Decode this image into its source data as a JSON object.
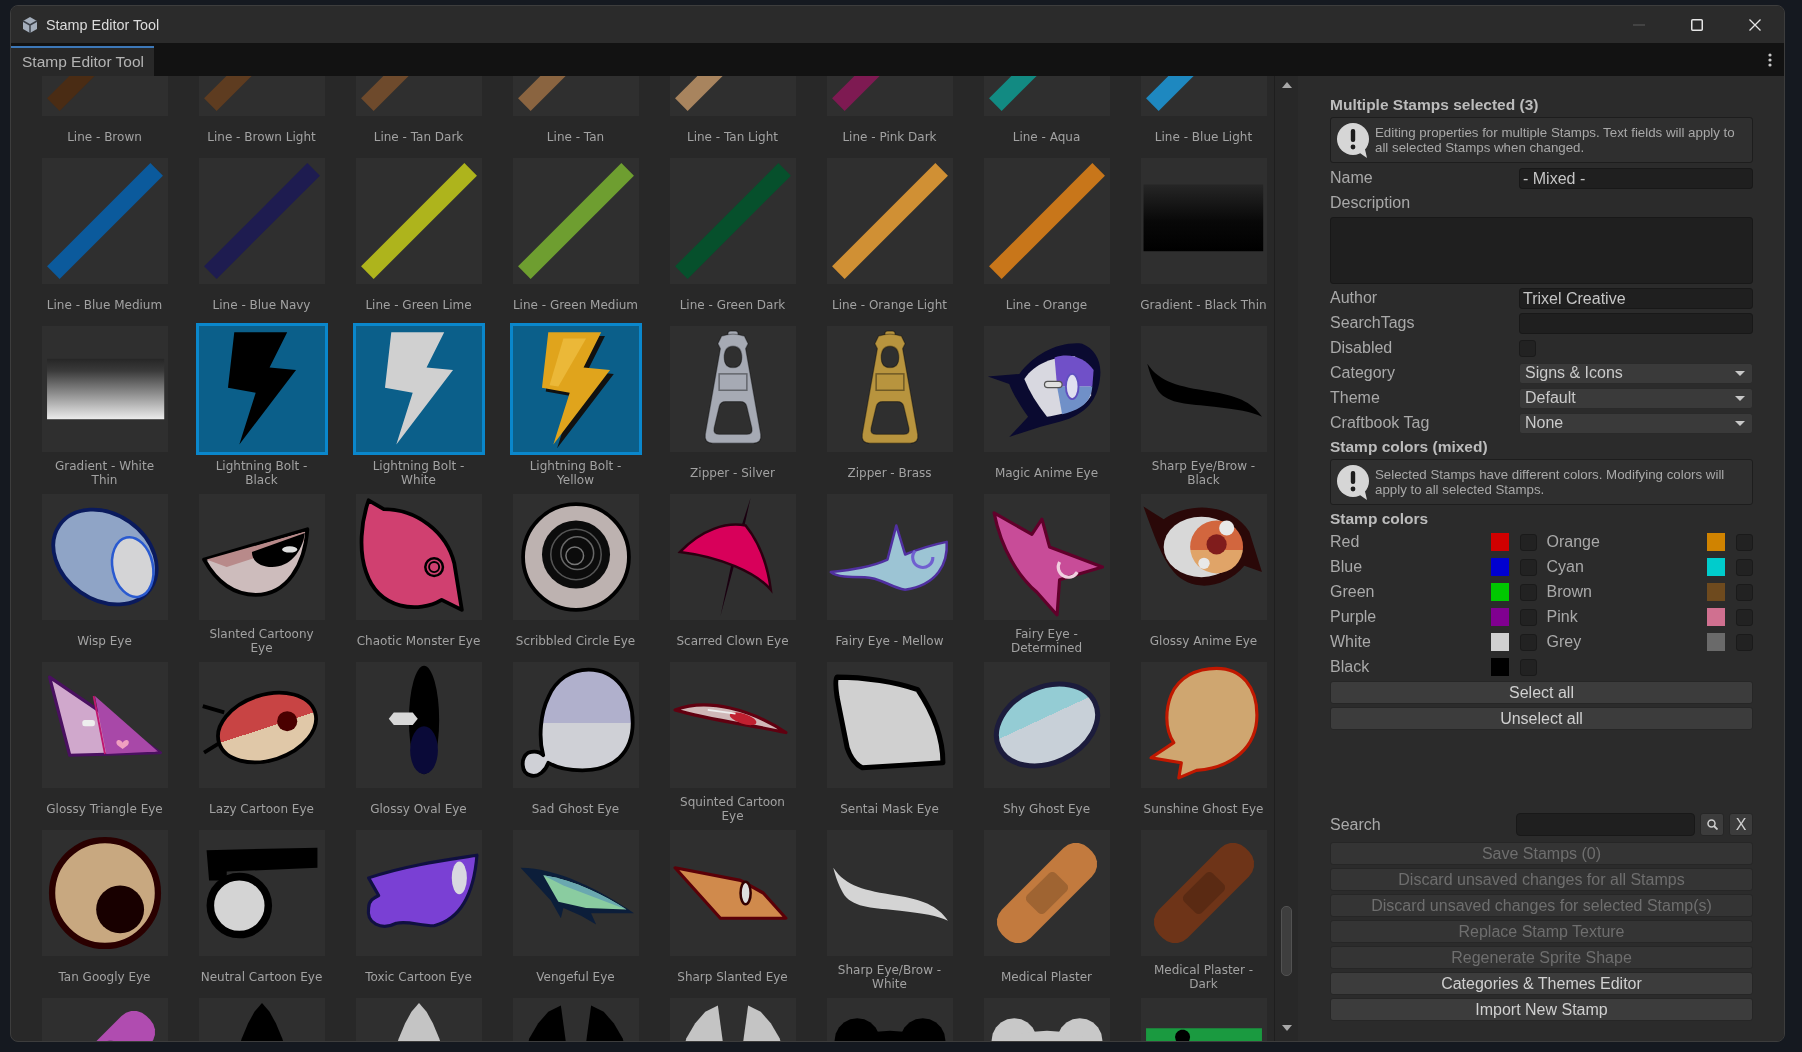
{
  "window": {
    "title": "Stamp Editor Tool",
    "controls": [
      {
        "kind": "minimize",
        "disabled": true
      },
      {
        "kind": "maximize",
        "disabled": false
      },
      {
        "kind": "close",
        "disabled": false
      }
    ]
  },
  "tabs": [
    {
      "label": "Stamp Editor Tool",
      "selected": true
    }
  ],
  "stamps": [
    {
      "label": "Line - Brown",
      "kind": "line",
      "color": "#4a2c14",
      "selected": false
    },
    {
      "label": "Line - Brown Light",
      "kind": "line",
      "color": "#5e3c20",
      "selected": false
    },
    {
      "label": "Line - Tan Dark",
      "kind": "line",
      "color": "#6e4a2c",
      "selected": false
    },
    {
      "label": "Line - Tan",
      "kind": "line",
      "color": "#8a6440",
      "selected": false
    },
    {
      "label": "Line - Tan Light",
      "kind": "line",
      "color": "#a8845e",
      "selected": false
    },
    {
      "label": "Line - Pink Dark",
      "kind": "line",
      "color": "#7e1a52",
      "selected": false
    },
    {
      "label": "Line - Aqua",
      "kind": "line",
      "color": "#128a82",
      "selected": false
    },
    {
      "label": "Line - Blue Light",
      "kind": "line",
      "color": "#1e88c0",
      "selected": false
    },
    {
      "label": "Line - Blue Medium",
      "kind": "line",
      "color": "#0b5a9c",
      "selected": false
    },
    {
      "label": "Line - Blue Navy",
      "kind": "line",
      "color": "#1e1c50",
      "selected": false
    },
    {
      "label": "Line - Green Lime",
      "kind": "line",
      "color": "#aeb41c",
      "selected": false
    },
    {
      "label": "Line - Green Medium",
      "kind": "line",
      "color": "#6e9e30",
      "selected": false
    },
    {
      "label": "Line - Green Dark",
      "kind": "line",
      "color": "#06502c",
      "selected": false
    },
    {
      "label": "Line - Orange Light",
      "kind": "line",
      "color": "#d09034",
      "selected": false
    },
    {
      "label": "Line - Orange",
      "kind": "line",
      "color": "#c8761a",
      "selected": false
    },
    {
      "label": "Gradient - Black Thin",
      "kind": "darkfade",
      "selected": false
    },
    {
      "label": "Gradient - White Thin",
      "kind": "lightfade",
      "selected": false
    },
    {
      "label": "Lightning Bolt - Black",
      "kind": "bolt",
      "color": "#000000",
      "selected": true
    },
    {
      "label": "Lightning Bolt - White",
      "kind": "bolt",
      "color": "#d0d0d0",
      "selected": true
    },
    {
      "label": "Lightning Bolt - Yellow",
      "kind": "glossybolt",
      "color": "#e0a41c",
      "selected": true
    },
    {
      "label": "Zipper - Silver",
      "kind": "zipper",
      "color": "#a6aab4",
      "selected": false
    },
    {
      "label": "Zipper - Brass",
      "kind": "zipper",
      "color": "#b8943e",
      "selected": false
    },
    {
      "label": "Magic Anime Eye",
      "kind": "magic",
      "selected": false
    },
    {
      "label": "Sharp Eye/Brow - Black",
      "kind": "brow",
      "color": "#000000",
      "selected": false
    },
    {
      "label": "Wisp Eye",
      "kind": "wisp",
      "selected": false
    },
    {
      "label": "Slanted Cartoony Eye",
      "kind": "slanted",
      "selected": false
    },
    {
      "label": "Chaotic Monster Eye",
      "kind": "monster",
      "selected": false
    },
    {
      "label": "Scribbled Circle Eye",
      "kind": "scribble",
      "selected": false
    },
    {
      "label": "Scarred Clown Eye",
      "kind": "clown",
      "selected": false
    },
    {
      "label": "Fairy Eye - Mellow",
      "kind": "fairy",
      "selected": false
    },
    {
      "label": "Fairy Eye - Determined",
      "kind": "spiky",
      "selected": false
    },
    {
      "label": "Glossy Anime Eye",
      "kind": "anime",
      "selected": false
    },
    {
      "label": "Glossy Triangle Eye",
      "kind": "triangle",
      "selected": false
    },
    {
      "label": "Lazy Cartoon Eye",
      "kind": "lazy",
      "selected": false
    },
    {
      "label": "Glossy Oval Eye",
      "kind": "oval",
      "selected": false
    },
    {
      "label": "Sad Ghost Eye",
      "kind": "ghost",
      "selected": false
    },
    {
      "label": "Squinted Cartoon Eye",
      "kind": "squint",
      "selected": false
    },
    {
      "label": "Sentai Mask Eye",
      "kind": "mask",
      "selected": false
    },
    {
      "label": "Shy Ghost Eye",
      "kind": "shy",
      "selected": false
    },
    {
      "label": "Sunshine Ghost Eye",
      "kind": "bubble",
      "selected": false
    },
    {
      "label": "Tan Googly Eye",
      "kind": "googly",
      "selected": false
    },
    {
      "label": "Neutral Cartoon Eye",
      "kind": "neutral",
      "selected": false
    },
    {
      "label": "Toxic Cartoon Eye",
      "kind": "toxic",
      "selected": false
    },
    {
      "label": "Vengeful Eye",
      "kind": "vengeful",
      "selected": false
    },
    {
      "label": "Sharp Slanted Eye",
      "kind": "sharp",
      "selected": false
    },
    {
      "label": "Sharp Eye/Brow - White",
      "kind": "brow",
      "color": "#d4d4d4",
      "selected": false
    },
    {
      "label": "Medical Plaster",
      "kind": "bandage",
      "color": "#c27a3e",
      "selected": false
    },
    {
      "label": "Medical Plaster - Dark",
      "kind": "bandage",
      "color": "#6e3418",
      "selected": false
    },
    {
      "kind": "bandage",
      "color": "#b04cb0",
      "selected": false
    },
    {
      "kind": "ear",
      "color": "#000000",
      "selected": false
    },
    {
      "kind": "ear",
      "color": "#c4c4c4",
      "selected": false
    },
    {
      "kind": "ears",
      "color": "#000000",
      "selected": false
    },
    {
      "kind": "ears",
      "color": "#c4c4c4",
      "selected": false
    },
    {
      "kind": "cloud",
      "color": "#000000",
      "selected": false
    },
    {
      "kind": "cloud",
      "color": "#c8c8c8",
      "selected": false
    },
    {
      "kind": "strip",
      "selected": false
    }
  ],
  "inspector": {
    "heading": "Multiple Stamps selected (3)",
    "notice": "Editing properties for multiple Stamps. Text fields will apply to all selected Stamps when changed.",
    "fields": [
      {
        "kind": "text",
        "label": "Name",
        "value": "- Mixed -"
      },
      {
        "kind": "textarea",
        "label": "Description"
      },
      {
        "kind": "text",
        "label": "Author",
        "value": "Trixel Creative"
      },
      {
        "kind": "text",
        "label": "SearchTags"
      },
      {
        "kind": "checkbox",
        "label": "Disabled",
        "checked": false
      },
      {
        "kind": "dropdown",
        "label": "Category",
        "value": "Signs & Icons"
      },
      {
        "kind": "dropdown",
        "label": "Theme",
        "value": "Default"
      },
      {
        "kind": "dropdown",
        "label": "Craftbook Tag",
        "value": "None"
      }
    ],
    "colors_heading": "Stamp colors (mixed)",
    "colors_notice": "Selected Stamps have different colors. Modifying colors will apply to all selected Stamps.",
    "colors_title": "Stamp colors",
    "colors": [
      {
        "label": "Red",
        "color": "#d00000",
        "checked": false
      },
      {
        "label": "Orange",
        "color": "#d08300",
        "checked": false
      },
      {
        "label": "Blue",
        "color": "#0000d0",
        "checked": false
      },
      {
        "label": "Cyan",
        "color": "#00cccc",
        "checked": false
      },
      {
        "label": "Green",
        "color": "#00c800",
        "checked": false
      },
      {
        "label": "Brown",
        "color": "#6e4a1e",
        "checked": false
      },
      {
        "label": "Purple",
        "color": "#800090",
        "checked": false
      },
      {
        "label": "Pink",
        "color": "#d07090",
        "checked": false
      },
      {
        "label": "White",
        "color": "#d0d0d0",
        "checked": false
      },
      {
        "label": "Grey",
        "color": "#6a6a6a",
        "checked": false
      },
      {
        "label": "Black",
        "color": "#000000",
        "checked": false
      }
    ],
    "color_buttons": [
      "Select all",
      "Unselect all"
    ],
    "search": {
      "label": "Search",
      "clear_label": "X"
    },
    "actions": [
      {
        "label": "Save Stamps (0)",
        "disabled": true
      },
      {
        "label": "Discard unsaved changes for all Stamps",
        "disabled": true
      },
      {
        "label": "Discard unsaved changes for selected Stamp(s)",
        "disabled": true
      },
      {
        "label": "Replace Stamp Texture",
        "disabled": true
      },
      {
        "label": "Regenerate Sprite Shape",
        "disabled": true
      },
      {
        "label": "Categories & Themes Editor",
        "disabled": false
      },
      {
        "label": "Import New Stamp",
        "disabled": false
      }
    ]
  }
}
